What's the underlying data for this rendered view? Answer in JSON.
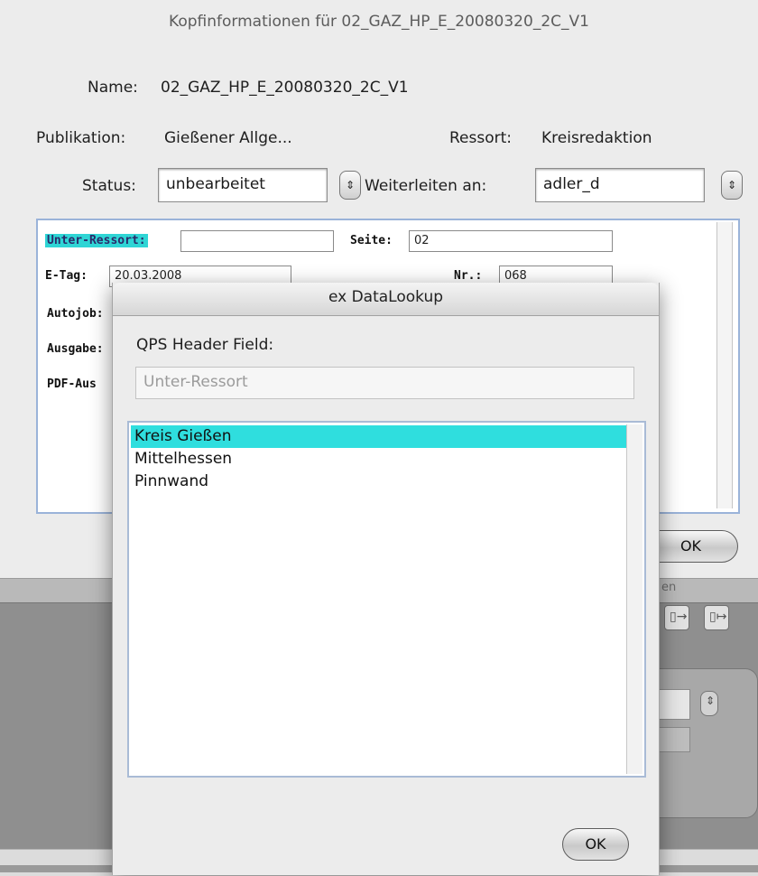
{
  "main_dialog": {
    "title": "Kopfinformationen für 02_GAZ_HP_E_20080320_2C_V1",
    "name_label": "Name:",
    "name_value": "02_GAZ_HP_E_20080320_2C_V1",
    "publication_label": "Publikation:",
    "publication_value": "Gießener Allge...",
    "ressort_label": "Ressort:",
    "ressort_value": "Kreisredaktion",
    "status_label": "Status:",
    "status_value": "unbearbeitet",
    "forward_label": "Weiterleiten an:",
    "forward_value": "adler_d",
    "ok_label": "OK"
  },
  "fields_panel": {
    "unter_ressort_label": "Unter-Ressort:",
    "unter_ressort_value": "",
    "seite_label": "Seite:",
    "seite_value": "02",
    "etag_label": "E-Tag:",
    "etag_value": "20.03.2008",
    "nr_label": "Nr.:",
    "nr_value": "068",
    "autojob_label": "Autojob:",
    "ausgabe_label": "Ausgabe:",
    "pdf_label": "PDF-Aus"
  },
  "lookup_dialog": {
    "title": "ex DataLookup",
    "field_label": "QPS Header Field:",
    "field_value": "Unter-Ressort",
    "items": [
      "Kreis Gießen",
      "Mittelhessen",
      "Pinnwand"
    ],
    "selected_index": 0,
    "ok_label": "OK"
  },
  "background": {
    "strip_text": "en"
  },
  "icons": {
    "stepper": "up-down-arrows-icon",
    "export": "export-icon",
    "export_all": "export-all-icon"
  },
  "colors": {
    "selection": "#2fdede",
    "highlight_label": "#2fd5d5"
  }
}
